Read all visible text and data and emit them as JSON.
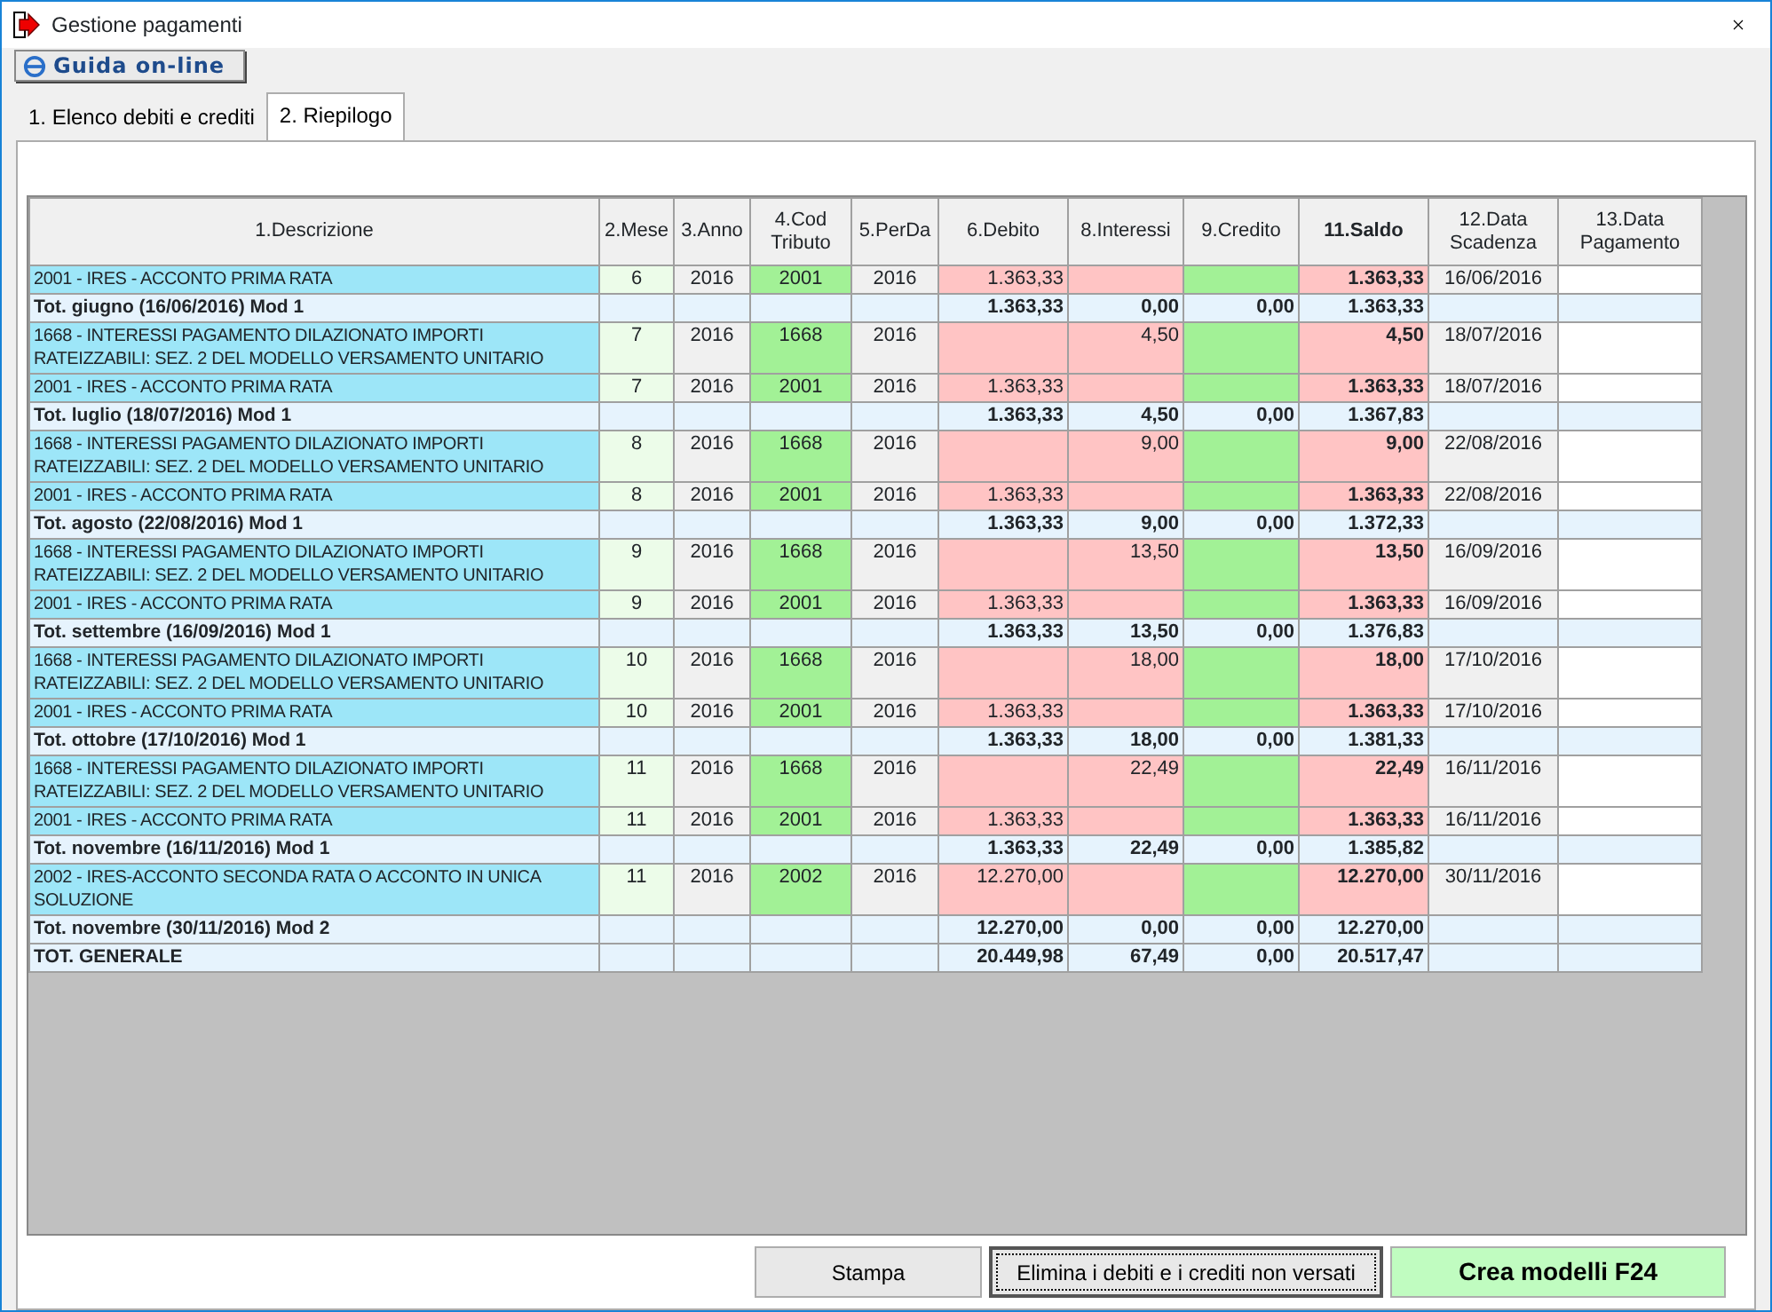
{
  "window": {
    "title": "Gestione pagamenti"
  },
  "help_button": {
    "label": "Guida on-line"
  },
  "tabs": [
    {
      "label": "1. Elenco debiti e crediti",
      "selected": false
    },
    {
      "label": "2. Riepilogo",
      "selected": true
    }
  ],
  "table": {
    "columns": [
      "1.Descrizione",
      "2.Mese",
      "3.Anno",
      "4.Cod Tributo",
      "5.PerDa",
      "6.Debito",
      "8.Interessi",
      "9.Credito",
      "11.Saldo",
      "12.Data Scadenza",
      "13.Data Pagamento"
    ],
    "rows": [
      {
        "kind": "item",
        "cells": [
          "2001 - IRES - ACCONTO PRIMA RATA",
          "6",
          "2016",
          "2001",
          "2016",
          "1.363,33",
          "",
          "",
          "1.363,33",
          "16/06/2016",
          ""
        ]
      },
      {
        "kind": "total",
        "cells": [
          "Tot. giugno (16/06/2016) Mod 1",
          "",
          "",
          "",
          "",
          "1.363,33",
          "0,00",
          "0,00",
          "1.363,33",
          "",
          ""
        ]
      },
      {
        "kind": "item",
        "cells": [
          "1668 - INTERESSI PAGAMENTO DILAZIONATO IMPORTI RATEIZZABILI: SEZ. 2 DEL MODELLO VERSAMENTO UNITARIO",
          "7",
          "2016",
          "1668",
          "2016",
          "",
          "4,50",
          "",
          "4,50",
          "18/07/2016",
          ""
        ]
      },
      {
        "kind": "item",
        "cells": [
          "2001 - IRES - ACCONTO PRIMA RATA",
          "7",
          "2016",
          "2001",
          "2016",
          "1.363,33",
          "",
          "",
          "1.363,33",
          "18/07/2016",
          ""
        ]
      },
      {
        "kind": "total",
        "cells": [
          "Tot. luglio (18/07/2016) Mod 1",
          "",
          "",
          "",
          "",
          "1.363,33",
          "4,50",
          "0,00",
          "1.367,83",
          "",
          ""
        ]
      },
      {
        "kind": "item",
        "cells": [
          "1668 - INTERESSI PAGAMENTO DILAZIONATO IMPORTI RATEIZZABILI: SEZ. 2 DEL MODELLO VERSAMENTO UNITARIO",
          "8",
          "2016",
          "1668",
          "2016",
          "",
          "9,00",
          "",
          "9,00",
          "22/08/2016",
          ""
        ]
      },
      {
        "kind": "item",
        "cells": [
          "2001 - IRES - ACCONTO PRIMA RATA",
          "8",
          "2016",
          "2001",
          "2016",
          "1.363,33",
          "",
          "",
          "1.363,33",
          "22/08/2016",
          ""
        ]
      },
      {
        "kind": "total",
        "cells": [
          "Tot. agosto (22/08/2016) Mod 1",
          "",
          "",
          "",
          "",
          "1.363,33",
          "9,00",
          "0,00",
          "1.372,33",
          "",
          ""
        ]
      },
      {
        "kind": "item",
        "cells": [
          "1668 - INTERESSI PAGAMENTO DILAZIONATO IMPORTI RATEIZZABILI: SEZ. 2 DEL MODELLO VERSAMENTO UNITARIO",
          "9",
          "2016",
          "1668",
          "2016",
          "",
          "13,50",
          "",
          "13,50",
          "16/09/2016",
          ""
        ]
      },
      {
        "kind": "item",
        "cells": [
          "2001 - IRES - ACCONTO PRIMA RATA",
          "9",
          "2016",
          "2001",
          "2016",
          "1.363,33",
          "",
          "",
          "1.363,33",
          "16/09/2016",
          ""
        ]
      },
      {
        "kind": "total",
        "cells": [
          "Tot. settembre (16/09/2016) Mod 1",
          "",
          "",
          "",
          "",
          "1.363,33",
          "13,50",
          "0,00",
          "1.376,83",
          "",
          ""
        ]
      },
      {
        "kind": "item",
        "cells": [
          "1668 - INTERESSI PAGAMENTO DILAZIONATO IMPORTI RATEIZZABILI: SEZ. 2 DEL MODELLO VERSAMENTO UNITARIO",
          "10",
          "2016",
          "1668",
          "2016",
          "",
          "18,00",
          "",
          "18,00",
          "17/10/2016",
          ""
        ]
      },
      {
        "kind": "item",
        "cells": [
          "2001 - IRES - ACCONTO PRIMA RATA",
          "10",
          "2016",
          "2001",
          "2016",
          "1.363,33",
          "",
          "",
          "1.363,33",
          "17/10/2016",
          ""
        ]
      },
      {
        "kind": "total",
        "cells": [
          "Tot. ottobre (17/10/2016) Mod 1",
          "",
          "",
          "",
          "",
          "1.363,33",
          "18,00",
          "0,00",
          "1.381,33",
          "",
          ""
        ]
      },
      {
        "kind": "item",
        "cells": [
          "1668 - INTERESSI PAGAMENTO DILAZIONATO IMPORTI RATEIZZABILI: SEZ. 2 DEL MODELLO VERSAMENTO UNITARIO",
          "11",
          "2016",
          "1668",
          "2016",
          "",
          "22,49",
          "",
          "22,49",
          "16/11/2016",
          ""
        ]
      },
      {
        "kind": "item",
        "cells": [
          "2001 - IRES - ACCONTO PRIMA RATA",
          "11",
          "2016",
          "2001",
          "2016",
          "1.363,33",
          "",
          "",
          "1.363,33",
          "16/11/2016",
          ""
        ]
      },
      {
        "kind": "total",
        "cells": [
          "Tot. novembre (16/11/2016) Mod 1",
          "",
          "",
          "",
          "",
          "1.363,33",
          "22,49",
          "0,00",
          "1.385,82",
          "",
          ""
        ]
      },
      {
        "kind": "item",
        "cells": [
          "2002 - IRES-ACCONTO SECONDA RATA O ACCONTO IN UNICA SOLUZIONE",
          "11",
          "2016",
          "2002",
          "2016",
          "12.270,00",
          "",
          "",
          "12.270,00",
          "30/11/2016",
          ""
        ]
      },
      {
        "kind": "total",
        "cells": [
          "Tot. novembre (30/11/2016) Mod 2",
          "",
          "",
          "",
          "",
          "12.270,00",
          "0,00",
          "0,00",
          "12.270,00",
          "",
          ""
        ]
      },
      {
        "kind": "total",
        "cells": [
          "TOT. GENERALE",
          "",
          "",
          "",
          "",
          "20.449,98",
          "67,49",
          "0,00",
          "20.517,47",
          "",
          ""
        ]
      }
    ]
  },
  "buttons": [
    {
      "label": "Stampa",
      "kind": "plain"
    },
    {
      "label": "Elimina i debiti e i crediti non versati",
      "kind": "focused"
    },
    {
      "label": "Crea modelli F24",
      "kind": "primary"
    }
  ]
}
